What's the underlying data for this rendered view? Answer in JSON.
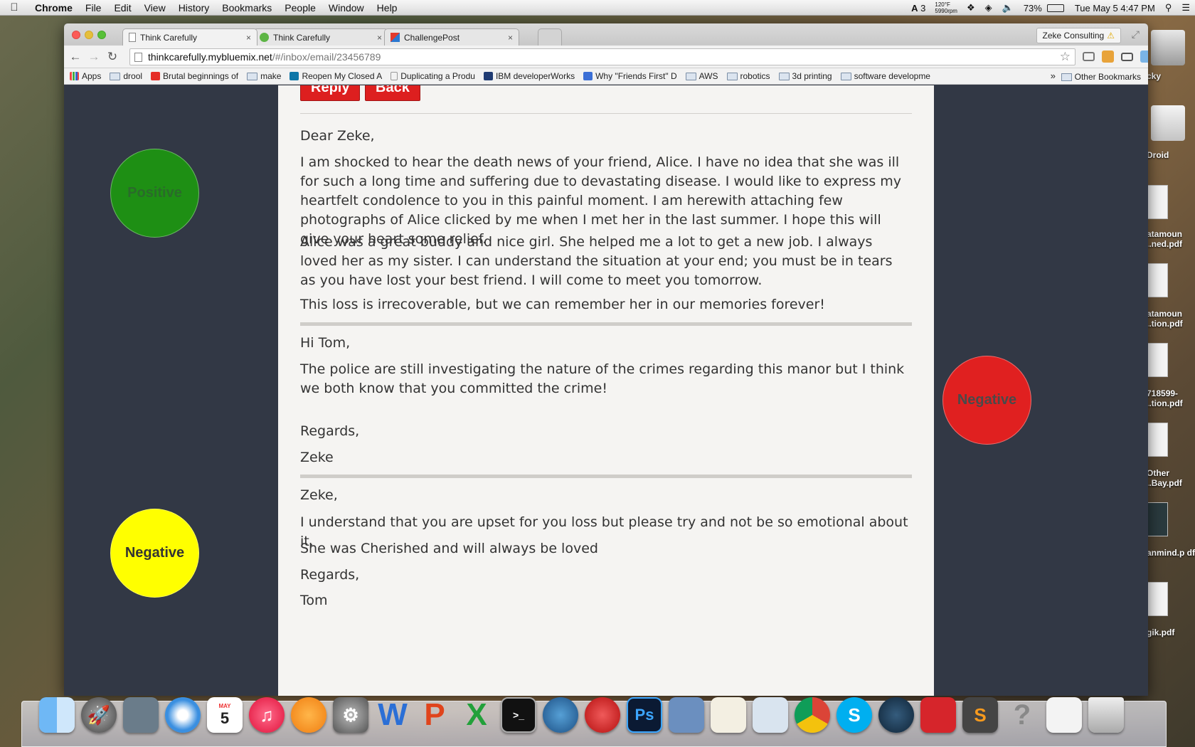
{
  "menubar": {
    "app": "Chrome",
    "items": [
      "File",
      "Edit",
      "View",
      "History",
      "Bookmarks",
      "People",
      "Window",
      "Help"
    ],
    "status": {
      "adobe_count": "3",
      "temp": "120°F",
      "fan": "5990rpm",
      "battery": "73%",
      "datetime": "Tue May 5  4:47 PM"
    }
  },
  "desktop": {
    "items": [
      {
        "label": "cky"
      },
      {
        "label": "Droid"
      },
      {
        "label": "atamoun ..ned.pdf"
      },
      {
        "label": "atamoun ..tion.pdf"
      },
      {
        "label": "718599- ..tion.pdf"
      },
      {
        "label": "Other ..Bay.pdf"
      },
      {
        "label": "anmind.p df"
      },
      {
        "label": "gik.pdf"
      }
    ]
  },
  "browser": {
    "tabs": [
      {
        "label": "Think Carefully",
        "close": "×"
      },
      {
        "label": "Think Carefully",
        "close": "×"
      },
      {
        "label": "ChallengePost",
        "close": "×"
      }
    ],
    "profile": "Zeke Consulting",
    "url_host": "thinkcarefully.mybluemix.net",
    "url_path": "/#/inbox/email/23456789",
    "bookmarks": [
      "drool",
      "Brutal beginnings of",
      "make",
      "Reopen My Closed A",
      "Duplicating a Produ",
      "IBM developerWorks",
      "Why \"Friends First\" D",
      "AWS",
      "robotics",
      "3d printing",
      "software developme"
    ],
    "apps_label": "Apps",
    "more": "»",
    "other_bookmarks": "Other Bookmarks"
  },
  "email": {
    "reply_label": "Reply",
    "back_label": "Back",
    "messages": [
      {
        "greeting": "Dear Zeke,",
        "paragraphs": [
          "I am shocked to hear the death news of your friend, Alice. I have no idea that she was ill for such a long time and suffering due to devastating disease. I would like to express my heartfelt condolence to you in this painful moment. I am herewith attaching few photographs of Alice clicked by me when I met her in the last summer. I hope this will give your heart some relief.",
          "Alice was a great buddy and nice girl. She helped me a lot to get a new job. I always loved her as my sister. I can understand the situation at your end; you must be in tears as you have lost your best friend. I will come to meet you tomorrow.",
          "This loss is irrecoverable, but we can remember her in our memories forever!"
        ]
      },
      {
        "greeting": "Hi Tom,",
        "paragraphs": [
          "The police are still investigating the nature of the crimes regarding this manor but I think we both know that you committed the crime!"
        ],
        "closing": "Regards,",
        "signature": "Zeke"
      },
      {
        "greeting": "Zeke,",
        "paragraphs": [
          "I understand that you are upset for you loss but please try and not be so emotional about it.",
          "She was Cherished and will always be loved"
        ],
        "closing": "Regards,",
        "signature": "Tom"
      }
    ]
  },
  "sentiment": {
    "first": {
      "label": "Positive",
      "color": "#1e8f14",
      "text_color": "#2a6b2a"
    },
    "second": {
      "label": "Negative",
      "color": "#e02020",
      "text_color": "#4a4a4a"
    },
    "third": {
      "label": "Negative",
      "color": "#ffff00",
      "text_color": "#333333"
    }
  },
  "dock": {
    "apps": [
      "Finder",
      "Launchpad",
      "Preview",
      "Safari",
      "Calendar",
      "iTunes",
      "iBooks",
      "System Preferences",
      "Word",
      "PowerPoint",
      "Excel",
      "Terminal",
      "SourceTree",
      "Sublime Beta",
      "Photoshop",
      "VirtualBox",
      "TextEdit",
      "Preview2",
      "Chrome",
      "Skype",
      "Steam",
      "Acrobat",
      "Sublime",
      "Help",
      "Documents",
      "Trash"
    ],
    "calendar_month": "MAY",
    "calendar_day": "5"
  }
}
